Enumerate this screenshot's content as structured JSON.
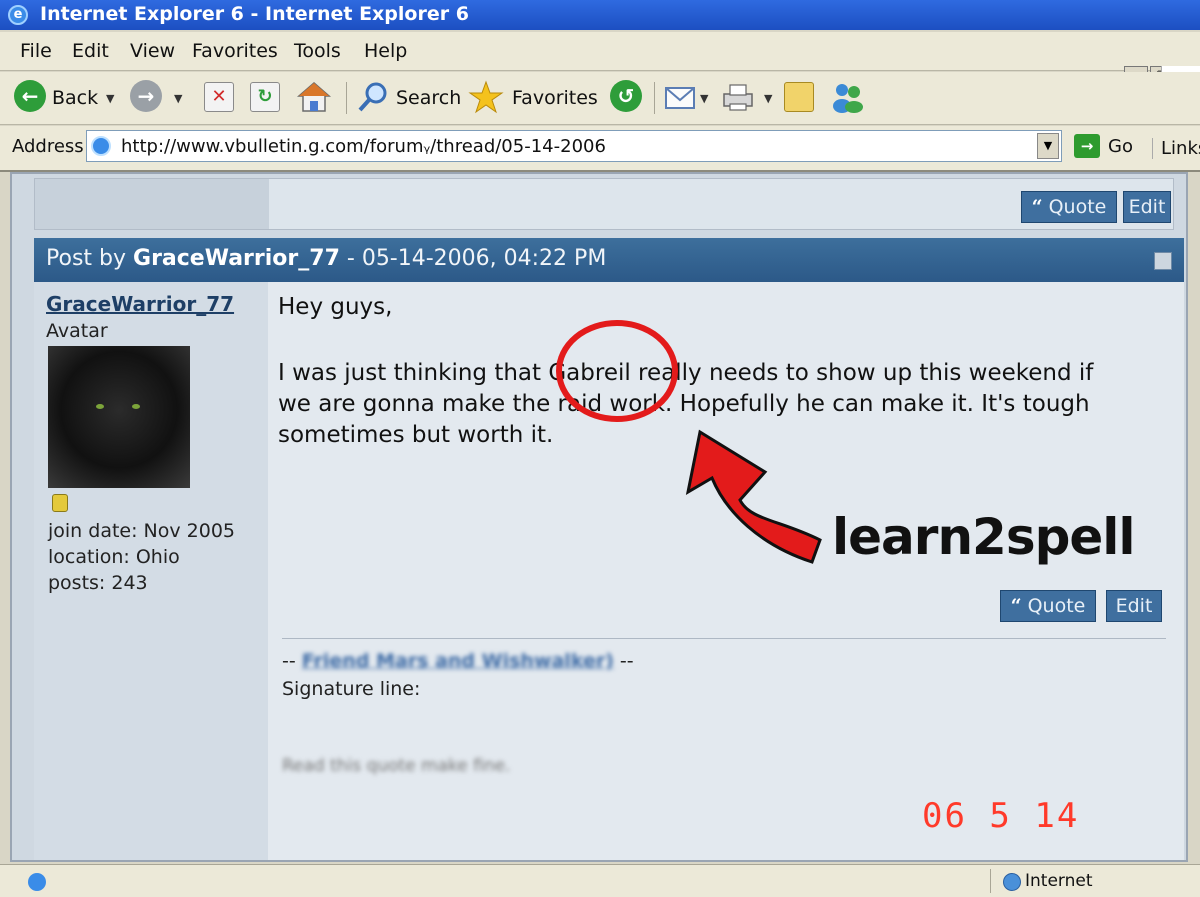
{
  "window": {
    "title": "Internet Explorer 6 - Internet Explorer 6"
  },
  "menu": [
    "File",
    "Edit",
    "View",
    "Favorites",
    "Tools",
    "Help"
  ],
  "toolbar": {
    "back": "Back",
    "search": "Search",
    "favorites": "Favorites"
  },
  "address": {
    "label": "Address",
    "url": "http://www.vbulletin.g.com/forumᵧ/thread/05-14-2006",
    "go": "Go",
    "links": "Links"
  },
  "buttons": {
    "quote": "Quote",
    "edit": "Edit",
    "quote_mark": "“"
  },
  "post": {
    "header_prefix": "Post by ",
    "header_user": "GraceWarrior_77",
    "header_suffix": " - 05-14-2006, 04:22 PM",
    "username": "GraceWarrior_77",
    "avatar_label": "Avatar",
    "join_date": "join date: Nov 2005",
    "location": "location: Ohio",
    "posts": "posts: 243",
    "greeting": "Hey guys,",
    "line1": "I was just thinking that Gabreil really needs to show up this weekend if",
    "line2": "we are gonna make the raid work. Hopefully he can make it. It's tough",
    "line3": "sometimes but worth it.",
    "sig_prefix": "-- ",
    "sig_link": "Friend Mars and Wishwalker)",
    "sig_suffix": " --",
    "sig_label": "Signature line:",
    "sig_blurred": "Read this quote make fine."
  },
  "annotation": {
    "text": "learn2spell",
    "color": "#e31b1b"
  },
  "camera_date": "06  5 14",
  "statusbar": {
    "zone": "Internet"
  },
  "colors": {
    "post_header": "#2f5f8f",
    "button": "#3f6f9f",
    "title_bar": "#2457cf"
  }
}
